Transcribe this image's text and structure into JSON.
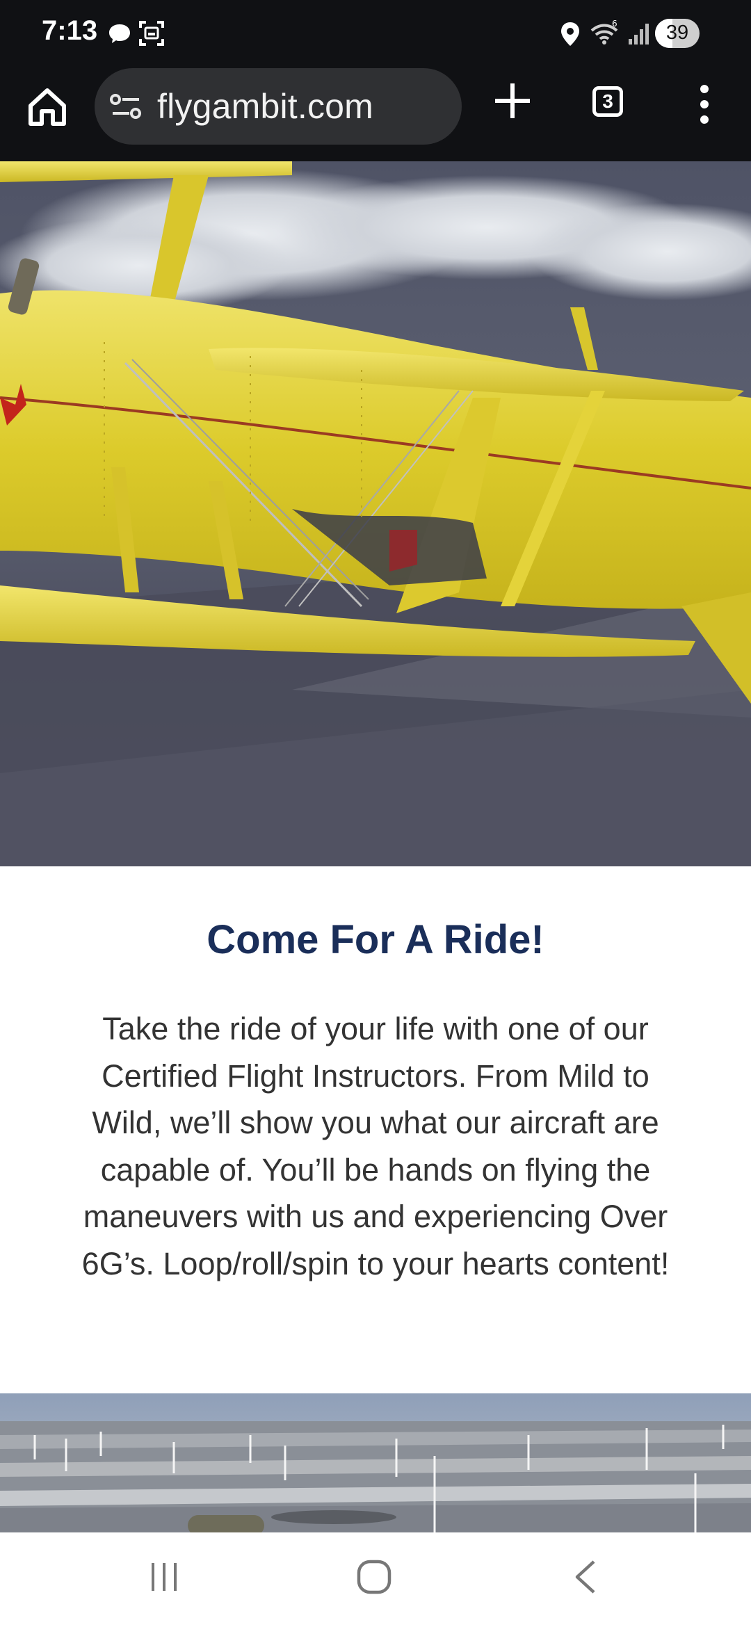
{
  "status_bar": {
    "time": "7:13",
    "battery": "39",
    "icons": [
      "chat-bubble-icon",
      "screenshot-icon",
      "location-icon",
      "wifi-icon",
      "signal-icon",
      "battery-icon"
    ]
  },
  "browser": {
    "url": "flygambit.com",
    "tab_count": "3",
    "icons": [
      "home-icon",
      "site-info-icon",
      "plus-icon",
      "tabs-icon",
      "more-vert-icon"
    ]
  },
  "hero_image": {
    "subject": "yellow biplane in flight"
  },
  "section": {
    "heading": "Come For A Ride!",
    "body": "Take the ride of your life with one of our Certified Flight Instructors. From Mild to Wild, we’ll show you what our aircraft are capable of. You’ll be hands on flying the maneuvers with us and experiencing Over 6G’s. Loop/roll/spin to your hearts content!"
  },
  "lower_image": {
    "subject": "aerial view of farmland with wind turbines"
  },
  "nav_bar": {
    "icons": [
      "recents-icon",
      "home-circle-icon",
      "back-icon"
    ]
  },
  "colors": {
    "chrome_bg": "#101114",
    "url_bar_bg": "#2f3033",
    "heading": "#1a2e59",
    "body_text": "#333333",
    "plane_yellow": "#e6d233"
  }
}
